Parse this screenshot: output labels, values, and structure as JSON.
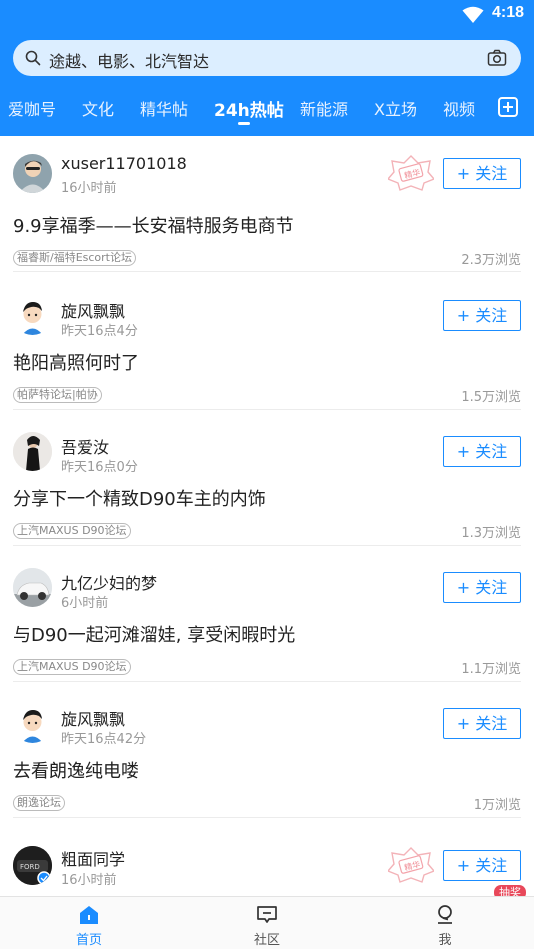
{
  "status_bar": {
    "time": "4:18"
  },
  "search": {
    "placeholder": "途越、电影、北汽智达"
  },
  "tabs": [
    {
      "label": "爱咖号"
    },
    {
      "label": "文化"
    },
    {
      "label": "精华帖"
    },
    {
      "label": "24h热帖",
      "active": true
    },
    {
      "label": "新能源"
    },
    {
      "label": "X立场"
    },
    {
      "label": "视频"
    }
  ],
  "follow_label": "+ 关注",
  "posts": [
    {
      "user": "xuser11701018",
      "time": "16小时前",
      "title": "9.9享福季——长安福特服务电商节",
      "tag": "福睿斯/福特Escort论坛",
      "views": "2.3万浏览",
      "stamp": "精华"
    },
    {
      "user": "旋风飘飘",
      "time": "昨天16点4分",
      "title": "艳阳高照何时了",
      "tag": "帕萨特论坛|帕协",
      "views": "1.5万浏览"
    },
    {
      "user": "吾爱汝",
      "time": "昨天16点0分",
      "title": "分享下一个精致D90车主的内饰",
      "tag": "上汽MAXUS D90论坛",
      "views": "1.3万浏览"
    },
    {
      "user": "九亿少妇的梦",
      "time": "6小时前",
      "title": "与D90一起河滩溜娃, 享受闲暇时光",
      "tag": "上汽MAXUS D90论坛",
      "views": "1.1万浏览"
    },
    {
      "user": "旋风飘飘",
      "time": "昨天16点42分",
      "title": "去看朗逸纯电喽",
      "tag": "朗逸论坛",
      "views": "1万浏览"
    },
    {
      "user": "粗面同学",
      "time": "16小时前",
      "stamp": "精华"
    }
  ],
  "bottom_nav": [
    {
      "label": "首页",
      "active": true
    },
    {
      "label": "社区"
    },
    {
      "label": "我"
    }
  ],
  "badge": {
    "label": "抽奖"
  },
  "colors": {
    "accent": "#1a8cff",
    "badge": "#e8485a"
  }
}
